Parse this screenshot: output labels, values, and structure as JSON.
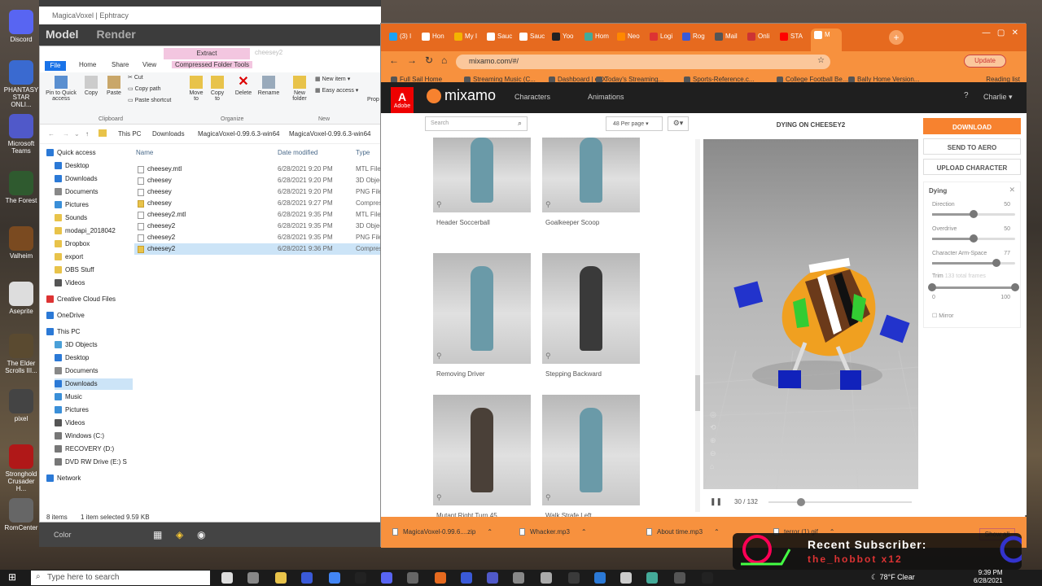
{
  "desktop": {
    "icons": [
      {
        "label": "Discord",
        "color": "#5865f2"
      },
      {
        "label": "PHANTASY STAR ONLI...",
        "color": "#3a6ad0"
      },
      {
        "label": "Microsoft Teams",
        "color": "#5059c9"
      },
      {
        "label": "The Forest",
        "color": "#2f5a2f"
      },
      {
        "label": "Valheim",
        "color": "#7a4a20"
      },
      {
        "label": "Aseprite",
        "color": "#ddd"
      },
      {
        "label": "The Elder Scrolls III...",
        "color": "#5a4a30"
      },
      {
        "label": "pixel",
        "color": "#444"
      },
      {
        "label": "Stronghold Crusader H...",
        "color": "#b01818"
      },
      {
        "label": "RomCenter",
        "color": "#666"
      }
    ]
  },
  "magica": {
    "title": "MagicaVoxel | Ephtracy",
    "menu": [
      "Model",
      "Render"
    ],
    "bottom_label": "Color"
  },
  "explorer": {
    "extract_tab": "Extract",
    "extract_sub": "Compressed Folder Tools",
    "tabs": [
      "File",
      "Home",
      "Share",
      "View"
    ],
    "ribbon": {
      "pin": "Pin to Quick access",
      "copy": "Copy",
      "paste": "Paste",
      "cut": "Cut",
      "copy_path": "Copy path",
      "paste_shortcut": "Paste shortcut",
      "move_to": "Move to",
      "copy_to": "Copy to",
      "delete": "Delete",
      "rename": "Rename",
      "new_folder": "New folder",
      "new_item": "New item",
      "easy_access": "Easy access",
      "prop": "Prop",
      "groups": [
        "Clipboard",
        "Organize",
        "New"
      ]
    },
    "path": [
      "This PC",
      "Downloads",
      "MagicaVoxel-0.99.6.3-win64",
      "MagicaVoxel-0.99.6.3-win64"
    ],
    "nav": [
      {
        "label": "Quick access",
        "indent": 0,
        "color": "#2b79d6"
      },
      {
        "label": "Desktop",
        "indent": 1,
        "color": "#2b79d6"
      },
      {
        "label": "Downloads",
        "indent": 1,
        "color": "#2b79d6"
      },
      {
        "label": "Documents",
        "indent": 1,
        "color": "#888"
      },
      {
        "label": "Pictures",
        "indent": 1,
        "color": "#3a8fd8"
      },
      {
        "label": "Sounds",
        "indent": 1,
        "color": "#e8c34a"
      },
      {
        "label": "modapi_2018042",
        "indent": 1,
        "color": "#e8c34a"
      },
      {
        "label": "Dropbox",
        "indent": 1,
        "color": "#e8c34a"
      },
      {
        "label": "export",
        "indent": 1,
        "color": "#e8c34a"
      },
      {
        "label": "OBS Stuff",
        "indent": 1,
        "color": "#e8c34a"
      },
      {
        "label": "Videos",
        "indent": 1,
        "color": "#555"
      },
      {
        "label": "Creative Cloud Files",
        "indent": 0,
        "color": "#d33"
      },
      {
        "label": "OneDrive",
        "indent": 0,
        "color": "#2b79d6"
      },
      {
        "label": "This PC",
        "indent": 0,
        "color": "#2b79d6"
      },
      {
        "label": "3D Objects",
        "indent": 1,
        "color": "#4aa0d8"
      },
      {
        "label": "Desktop",
        "indent": 1,
        "color": "#2b79d6"
      },
      {
        "label": "Documents",
        "indent": 1,
        "color": "#888"
      },
      {
        "label": "Downloads",
        "indent": 1,
        "color": "#2b79d6"
      },
      {
        "label": "Music",
        "indent": 1,
        "color": "#3a8fd8"
      },
      {
        "label": "Pictures",
        "indent": 1,
        "color": "#3a8fd8"
      },
      {
        "label": "Videos",
        "indent": 1,
        "color": "#555"
      },
      {
        "label": "Windows (C:)",
        "indent": 1,
        "color": "#777"
      },
      {
        "label": "RECOVERY (D:)",
        "indent": 1,
        "color": "#777"
      },
      {
        "label": "DVD RW Drive (E:) S",
        "indent": 1,
        "color": "#777"
      },
      {
        "label": "Network",
        "indent": 0,
        "color": "#2b79d6"
      }
    ],
    "columns": [
      "Name",
      "Date modified",
      "Type"
    ],
    "files": [
      {
        "name": "cheesey.mtl",
        "date": "6/28/2021 9:20 PM",
        "type": "MTL File"
      },
      {
        "name": "cheesey",
        "date": "6/28/2021 9:20 PM",
        "type": "3D Object"
      },
      {
        "name": "cheesey",
        "date": "6/28/2021 9:20 PM",
        "type": "PNG File"
      },
      {
        "name": "cheesey",
        "date": "6/28/2021 9:27 PM",
        "type": "Compressed"
      },
      {
        "name": "cheesey2.mtl",
        "date": "6/28/2021 9:35 PM",
        "type": "MTL File"
      },
      {
        "name": "cheesey2",
        "date": "6/28/2021 9:35 PM",
        "type": "3D Object"
      },
      {
        "name": "cheesey2",
        "date": "6/28/2021 9:35 PM",
        "type": "PNG File"
      },
      {
        "name": "cheesey2",
        "date": "6/28/2021 9:36 PM",
        "type": "Compressed"
      }
    ],
    "selected_index": 7,
    "status_items": "8 items",
    "status_selected": "1 item selected  9.59 KB"
  },
  "browser": {
    "tabs": [
      {
        "label": "(3) I",
        "color": "#1da1f2"
      },
      {
        "label": "Hon",
        "color": "#fff"
      },
      {
        "label": "My I",
        "color": "#f4b400"
      },
      {
        "label": "Sauc",
        "color": "#fff"
      },
      {
        "label": "Sauc",
        "color": "#fff"
      },
      {
        "label": "Yoo",
        "color": "#222"
      },
      {
        "label": "Hom",
        "color": "#4a9"
      },
      {
        "label": "Neo",
        "color": "#f80"
      },
      {
        "label": "Logi",
        "color": "#d33"
      },
      {
        "label": "Rog",
        "color": "#3a5ad8"
      },
      {
        "label": "Mail",
        "color": "#555"
      },
      {
        "label": "Onli",
        "color": "#c33"
      },
      {
        "label": "STA",
        "color": "#f00"
      },
      {
        "label": "M",
        "color": "#fff"
      }
    ],
    "url": "mixamo.com/#/",
    "update_label": "Update",
    "bookmarks": [
      "Full Sail Home",
      "Streaming Music (C...",
      "Dashboard | edX",
      "Today's Streaming...",
      "Sports-Reference.c...",
      "College Football Be...",
      "Bally Home Version..."
    ],
    "reading_list": "Reading list",
    "downloads": [
      "MagicaVoxel-0.99.6....zip",
      "Whacker.mp3",
      "About time.mp3",
      "terror (1).gif"
    ],
    "show_all": "Show all"
  },
  "mixamo": {
    "brand": "mixamo",
    "adobe": "Adobe",
    "nav": [
      "Characters",
      "Animations"
    ],
    "user": "Charlie",
    "search_placeholder": "Search",
    "per_page": "48 Per page",
    "preview_title": "DYING ON CHEESEY2",
    "cards": [
      {
        "label": "Header Soccerball",
        "color": "#6a9aa8"
      },
      {
        "label": "Goalkeeper Scoop",
        "color": "#6a9aa8"
      },
      {
        "label": "Removing Driver",
        "color": "#6a9aa8"
      },
      {
        "label": "Stepping Backward",
        "color": "#3a3a3a"
      },
      {
        "label": "Mutant Right Turn 45",
        "color": "#4a4038"
      },
      {
        "label": "Walk Strafe Left",
        "color": "#6a9aa8"
      }
    ],
    "buttons": {
      "download": "DOWNLOAD",
      "send": "SEND TO AERO",
      "upload": "UPLOAD CHARACTER"
    },
    "panel_title": "Dying",
    "params": [
      {
        "label": "Direction",
        "value": "50",
        "level": 0.5
      },
      {
        "label": "Overdrive",
        "value": "50",
        "level": 0.5
      },
      {
        "label": "Character Arm-Space",
        "value": "77",
        "level": 0.77
      }
    ],
    "trim_label": "Trim",
    "trim_sub": "133 total frames",
    "trim_min": "0",
    "trim_max": "100",
    "mirror": "Mirror",
    "frame": "30 / 132",
    "frame_level": 0.23,
    "accent": "#f7822f"
  },
  "taskbar": {
    "search": "Type here to search",
    "weather": "78°F  Clear",
    "time": "9:39 PM",
    "date": "6/28/2021"
  },
  "overlay": {
    "title": "Recent Subscriber:",
    "name": "the_hobbot x12"
  }
}
